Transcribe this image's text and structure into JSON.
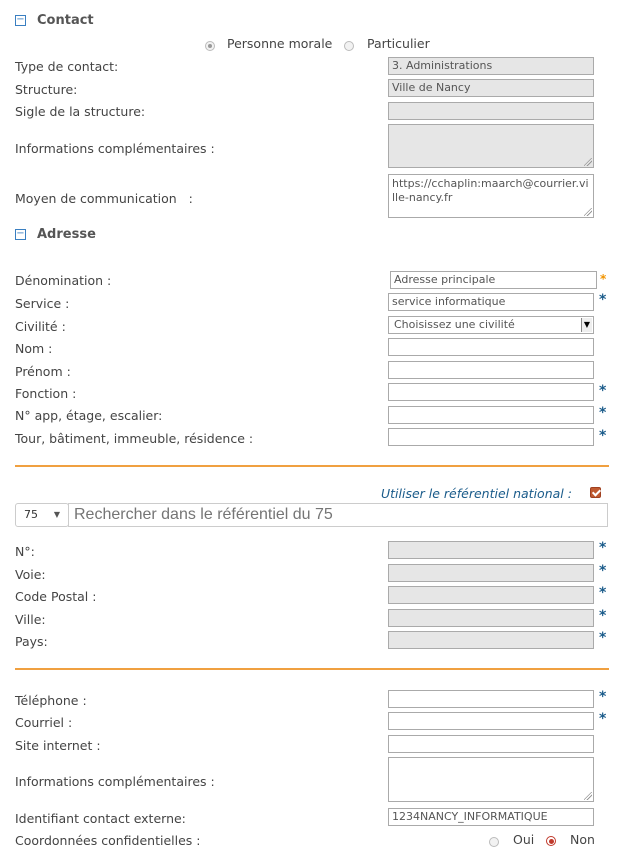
{
  "contact": {
    "title": "Contact",
    "radio_morale": "Personne morale",
    "radio_particulier": "Particulier",
    "type_label": "Type de contact:",
    "type_value": "3. Administrations",
    "structure_label": "Structure:",
    "structure_value": "Ville de Nancy",
    "sigle_label": "Sigle de la structure:",
    "info_label": "Informations complémentaires :",
    "moyen_label": "Moyen de communication   :",
    "moyen_value_1": "https://cchaplin:maarch@courrier.vi",
    "moyen_value_2": "lle-nancy.fr"
  },
  "adresse": {
    "title": "Adresse",
    "denomination_label": "Dénomination :",
    "denomination_value": "Adresse principale",
    "service_label": "Service :",
    "service_value": "service informatique",
    "civilite_label": "Civilité :",
    "civilite_value": "Choisissez une civilité",
    "nom_label": "Nom :",
    "prenom_label": "Prénom :",
    "fonction_label": "Fonction :",
    "napp_label": "N° app, étage, escalier:",
    "tour_label": "Tour, bâtiment, immeuble, résidence :"
  },
  "referentiel": {
    "label": "Utiliser le référentiel national :",
    "dept_value": "75",
    "search_placeholder": "Rechercher dans le référentiel du 75",
    "num_label": "N°:",
    "voie_label": "Voie:",
    "cp_label": "Code Postal :",
    "ville_label": "Ville:",
    "pays_label": "Pays:"
  },
  "coord": {
    "tel_label": "Téléphone :",
    "courriel_label": "Courriel :",
    "site_label": "Site internet :",
    "info_label": "Informations complémentaires :",
    "ident_label": "Identifiant contact externe:",
    "ident_value": "1234NANCY_INFORMATIQUE",
    "conf_label": "Coordonnées confidentielles :",
    "oui": "Oui",
    "non": "Non"
  },
  "required_mark": "*"
}
